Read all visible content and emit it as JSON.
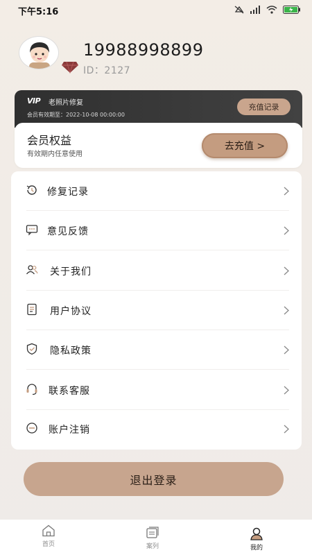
{
  "status_bar": {
    "time": "下午5:16",
    "battery_color": "#3ab54a"
  },
  "profile": {
    "phone": "19988998899",
    "id_text": "ID：2127"
  },
  "vip_card": {
    "logo": "VIP",
    "title": "老照片修复",
    "expire_text": "会员有效期至：2022-10-08 00:00:00",
    "recharge_record": "充值记录"
  },
  "benefits": {
    "title": "会员权益",
    "subtitle": "有效期内任意使用",
    "button": "去充值 >"
  },
  "menu": {
    "items": [
      {
        "label": "修复记录",
        "icon": "history-icon"
      },
      {
        "label": "意见反馈",
        "icon": "feedback-icon"
      },
      {
        "label": "关于我们",
        "icon": "users-icon"
      },
      {
        "label": "用户协议",
        "icon": "document-icon"
      },
      {
        "label": "隐私政策",
        "icon": "shield-icon"
      },
      {
        "label": "联系客服",
        "icon": "customer-service-icon"
      },
      {
        "label": "账户注销",
        "icon": "cancel-account-icon"
      }
    ]
  },
  "logout": {
    "label": "退出登录"
  },
  "tabs": [
    {
      "label": "首页",
      "icon": "home-icon",
      "active": false
    },
    {
      "label": "案列",
      "icon": "cases-icon",
      "active": false
    },
    {
      "label": "我的",
      "icon": "profile-icon",
      "active": true
    }
  ],
  "colors": {
    "accent": "#c7a58e",
    "card_dark": "#383838",
    "background": "#f1ece7"
  }
}
